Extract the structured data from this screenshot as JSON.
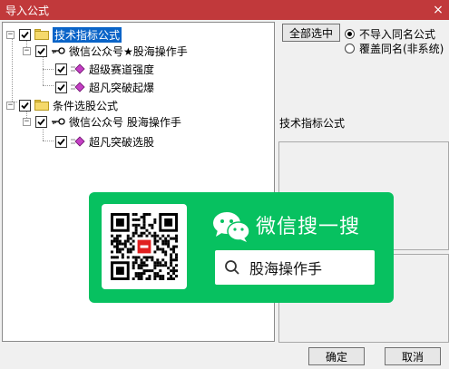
{
  "window": {
    "title": "导入公式",
    "close_glyph": "×"
  },
  "tree": {
    "groups": [
      {
        "label": "技术指标公式",
        "checked": true,
        "selected": true,
        "children": [
          {
            "label": "微信公众号★股海操作手",
            "checked": true,
            "items": [
              {
                "label": "超级赛道强度",
                "checked": true
              },
              {
                "label": "超凡突破起爆",
                "checked": true
              }
            ]
          }
        ]
      },
      {
        "label": "条件选股公式",
        "checked": true,
        "selected": false,
        "children": [
          {
            "label": "微信公众号 股海操作手",
            "checked": true,
            "items": [
              {
                "label": "超凡突破选股",
                "checked": true
              }
            ]
          }
        ]
      }
    ],
    "expander_glyph": "−"
  },
  "options": {
    "select_all_label": "全部选中",
    "radio_options": [
      {
        "label": "不导入同名公式",
        "selected": true
      },
      {
        "label": "覆盖同名(非系统)",
        "selected": false
      }
    ]
  },
  "description": {
    "section_label": "技术指标公式"
  },
  "footer": {
    "ok_label": "确定",
    "cancel_label": "取消"
  },
  "overlay": {
    "title": "微信搜一搜",
    "search_text": "股海操作手",
    "icons": [
      "qr-code-icon",
      "wechat-logo-icon",
      "search-icon"
    ]
  },
  "colors": {
    "titlebar": "#c1393b",
    "selection": "#0a64c8",
    "overlay_green": "#07c160",
    "item_icon": "#c43fc4"
  }
}
